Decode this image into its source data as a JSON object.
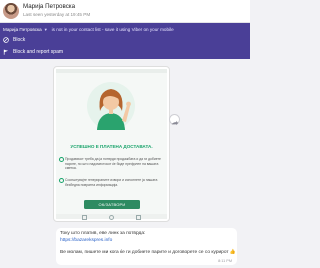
{
  "header": {
    "contact_name": "Марија Петровска",
    "last_seen": "Last seen yesterday at 19:45 PM"
  },
  "spam_banner": {
    "name": "Марија Петровска",
    "message": "is not in your contact list - save it using Viber on your mobile",
    "actions": [
      {
        "label": "Block",
        "icon": "block-icon"
      },
      {
        "label": "Block and report spam",
        "icon": "flag-icon"
      }
    ],
    "background_color": "#4a3f97"
  },
  "image_message": {
    "success_title": "УСПЕШНО Е ПЛАТЕНА ДОСТАВАТА.",
    "bullets": [
      "Продавачот треба да ја потврди продажбата и да ги добиете парите, по што надоместокот ќе биде префрлен на вашата сметка.",
      "Соопштувајте генерираните извори и исполнете ја нашата безбедна повратна информација."
    ],
    "ok_button": "ОК/ЗАТВОРИ",
    "accent_color": "#18a36a"
  },
  "text_message": {
    "line1": "Току што платив, еве линк за потврда:",
    "link": "https://bazarekspres.info",
    "line3": "Ве молам, пишете ми кога ќе ги добиете парите и договорете се со курирот 👍",
    "time": "8:11 PM"
  }
}
